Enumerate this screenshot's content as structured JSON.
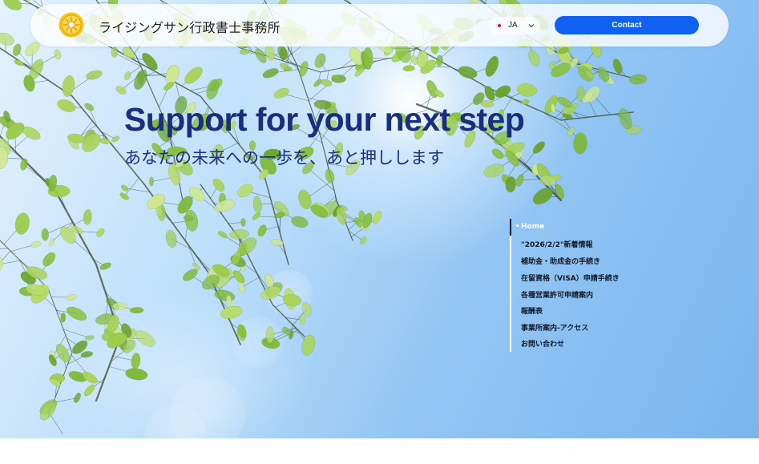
{
  "header": {
    "site_title": "ライジングサン行政書士事務所",
    "language": {
      "code": "JA"
    },
    "contact_label": "Contact"
  },
  "hero": {
    "headline": "Support for your next step",
    "subline": "あなたの未来への一歩を、あと押しします"
  },
  "sidenav": {
    "items": [
      {
        "label": "Home",
        "active": true
      },
      {
        "label": "\"2026/2/2\"新着情報",
        "active": false
      },
      {
        "label": "補助金・助成金の手続き",
        "active": false
      },
      {
        "label": "在留資格（VISA）申請手続き",
        "active": false
      },
      {
        "label": "各種営業許可申請案内",
        "active": false
      },
      {
        "label": "報酬表",
        "active": false
      },
      {
        "label": "事業所案内-アクセス",
        "active": false
      },
      {
        "label": "お問い合わせ",
        "active": false
      }
    ]
  },
  "colors": {
    "accent": "#1060f2",
    "headline": "#1a2e7e",
    "sky": "#93c6f4",
    "leaf": "#8cc63f"
  }
}
